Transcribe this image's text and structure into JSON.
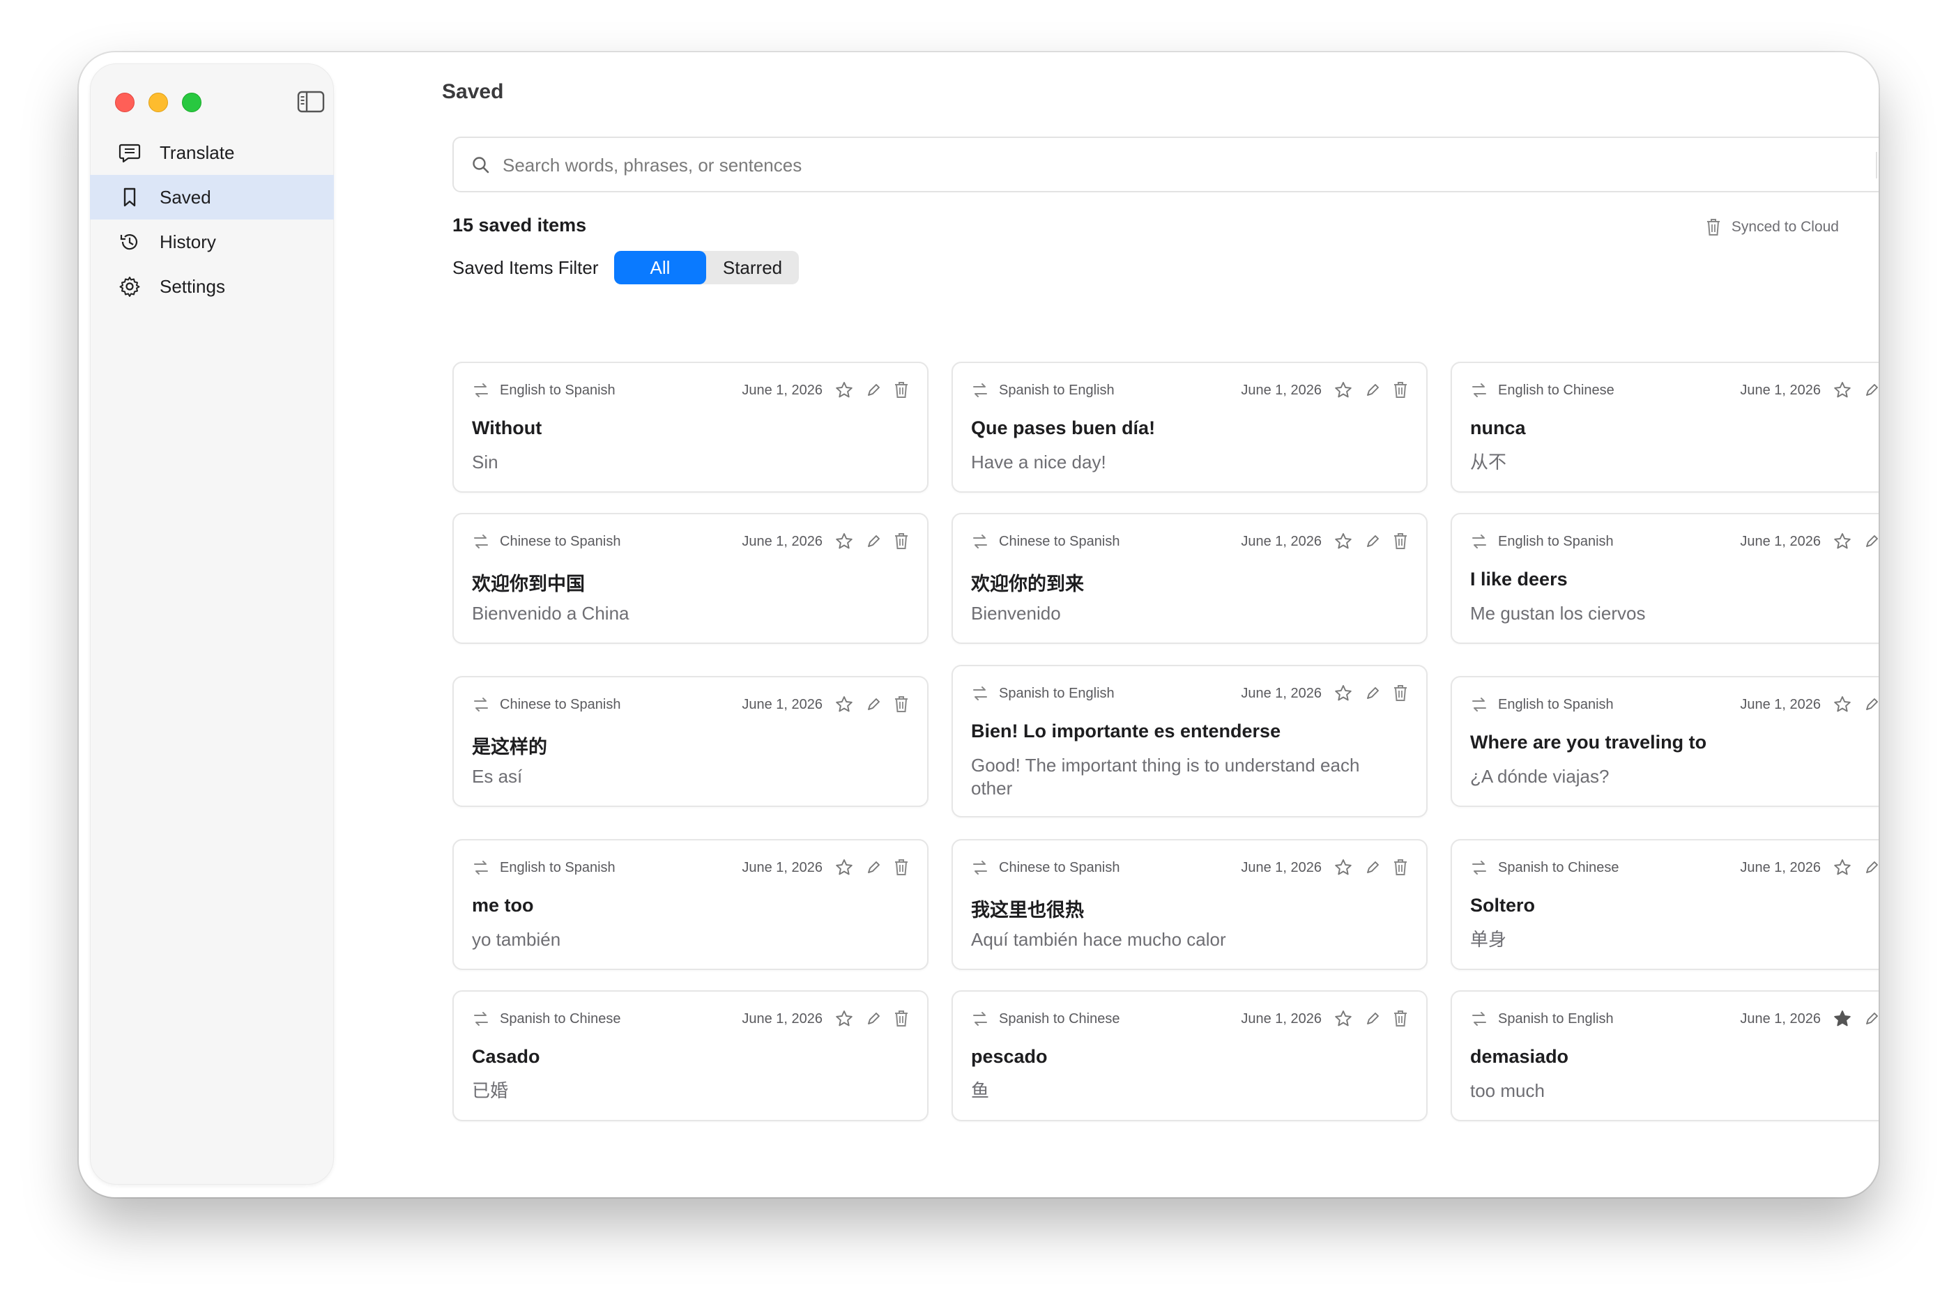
{
  "page": {
    "title": "Saved"
  },
  "sidebar": {
    "items": [
      {
        "label": "Translate",
        "icon": "message-icon"
      },
      {
        "label": "Saved",
        "icon": "bookmark-icon"
      },
      {
        "label": "History",
        "icon": "clock-icon"
      },
      {
        "label": "Settings",
        "icon": "gear-icon"
      }
    ],
    "active": "Saved"
  },
  "search": {
    "placeholder": "Search words, phrases, or sentences",
    "value": ""
  },
  "summary": {
    "count_label": "15 saved items",
    "sync_label": "Synced to Cloud"
  },
  "filter": {
    "label": "Saved Items Filter",
    "options": [
      "All",
      "Starred"
    ],
    "selected": "All"
  },
  "colors": {
    "accent": "#0a7aff",
    "active_nav": "#dce6f7"
  },
  "cards": [
    {
      "direction": "English to Spanish",
      "date": "June 1, 2026",
      "source": "Without",
      "translation": "Sin",
      "starred": false
    },
    {
      "direction": "Spanish to English",
      "date": "June 1, 2026",
      "source": "Que pases buen día!",
      "translation": "Have a nice day!",
      "starred": false
    },
    {
      "direction": "English to Chinese",
      "date": "June 1, 2026",
      "source": "nunca",
      "translation": "从不",
      "starred": false
    },
    {
      "direction": "Chinese to Spanish",
      "date": "June 1, 2026",
      "source": "欢迎你到中国",
      "translation": "Bienvenido a China",
      "starred": false
    },
    {
      "direction": "Chinese to Spanish",
      "date": "June 1, 2026",
      "source": "欢迎你的到来",
      "translation": "Bienvenido",
      "starred": false
    },
    {
      "direction": "English to Spanish",
      "date": "June 1, 2026",
      "source": "I like deers",
      "translation": "Me gustan los ciervos",
      "starred": false
    },
    {
      "direction": "Chinese to Spanish",
      "date": "June 1, 2026",
      "source": "是这样的",
      "translation": "Es así",
      "starred": false
    },
    {
      "direction": "Spanish to English",
      "date": "June 1, 2026",
      "source": "Bien! Lo importante es entenderse",
      "translation": "Good! The important thing is to understand each other",
      "starred": false
    },
    {
      "direction": "English to Spanish",
      "date": "June 1, 2026",
      "source": "Where are you traveling to",
      "translation": "¿A dónde viajas?",
      "starred": false
    },
    {
      "direction": "English to Spanish",
      "date": "June 1, 2026",
      "source": "me too",
      "translation": "yo también",
      "starred": false
    },
    {
      "direction": "Chinese to Spanish",
      "date": "June 1, 2026",
      "source": "我这里也很热",
      "translation": "Aquí también hace mucho calor",
      "starred": false
    },
    {
      "direction": "Spanish to Chinese",
      "date": "June 1, 2026",
      "source": "Soltero",
      "translation": "单身",
      "starred": false
    },
    {
      "direction": "Spanish to Chinese",
      "date": "June 1, 2026",
      "source": "Casado",
      "translation": "已婚",
      "starred": false
    },
    {
      "direction": "Spanish to Chinese",
      "date": "June 1, 2026",
      "source": "pescado",
      "translation": "鱼",
      "starred": false
    },
    {
      "direction": "Spanish to English",
      "date": "June 1, 2026",
      "source": "demasiado",
      "translation": "too much",
      "starred": true
    }
  ]
}
